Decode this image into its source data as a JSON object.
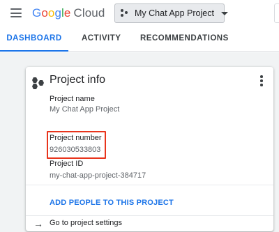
{
  "header": {
    "logo": {
      "g1": "G",
      "g2": "o",
      "g3": "o",
      "g4": "g",
      "g5": "l",
      "g6": "e",
      "cloud": "Cloud"
    },
    "project_picker": {
      "label": "My Chat App Project",
      "icon": "project-dots-icon",
      "caret": "chevron-down-icon"
    },
    "menu_icon": "hamburger-icon"
  },
  "tabs": [
    {
      "label": "DASHBOARD",
      "active": true
    },
    {
      "label": "ACTIVITY",
      "active": false
    },
    {
      "label": "RECOMMENDATIONS",
      "active": false
    }
  ],
  "card": {
    "title": "Project info",
    "icon": "hexagon-cluster-icon",
    "more_icon": "more-vert-icon",
    "fields": [
      {
        "label": "Project name",
        "value": "My Chat App Project"
      },
      {
        "label": "Project number",
        "value": "926030533803"
      },
      {
        "label": "Project ID",
        "value": "my-chat-app-project-384717"
      }
    ],
    "add_people_link": "ADD PEOPLE TO THIS PROJECT",
    "settings_link": {
      "icon": "arrow-right-icon",
      "label": "Go to project settings"
    }
  },
  "colors": {
    "accent": "#1a73e8",
    "highlight": "#e8341c",
    "page_background": "#f1f3f4"
  }
}
